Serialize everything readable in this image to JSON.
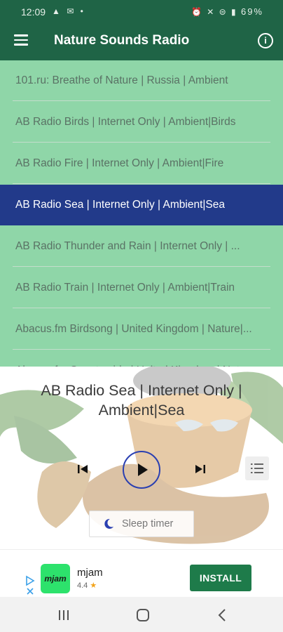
{
  "status_bar": {
    "time": "12:09",
    "left_icons": "▲ ✉ •",
    "right_icons": "⏰ ✕ ⊜ ▮",
    "battery": "69%"
  },
  "app_bar": {
    "title": "Nature Sounds Radio",
    "menu_icon": "hamburger-menu-icon",
    "info_icon": "info-icon",
    "info_glyph": "i"
  },
  "stations": [
    {
      "label": "101.ru: Breathe of Nature | Russia | Ambient",
      "selected": false
    },
    {
      "label": "AB Radio Birds | Internet Only | Ambient|Birds",
      "selected": false
    },
    {
      "label": "AB Radio Fire | Internet Only | Ambient|Fire",
      "selected": false
    },
    {
      "label": "AB Radio Sea | Internet Only | Ambient|Sea",
      "selected": true
    },
    {
      "label": "AB Radio Thunder and Rain | Internet Only | ...",
      "selected": false
    },
    {
      "label": "AB Radio Train | Internet Only | Ambient|Train",
      "selected": false
    },
    {
      "label": "Abacus.fm Birdsong | United Kingdom | Nature|...",
      "selected": false
    },
    {
      "label": "Abacus.fm Countryside | United Kingdom | Nature",
      "selected": false
    }
  ],
  "player": {
    "now_playing": "AB Radio Sea | Internet Only | Ambient|Sea",
    "sleep_timer_label": "Sleep timer"
  },
  "ad": {
    "app_name": "mjam",
    "logo_text": "mjam",
    "rating": "4.4",
    "install_label": "INSTALL"
  },
  "colors": {
    "app_bar": "#1f6446",
    "list_bg": "#8fd6a8",
    "selected_bg": "#223a8a",
    "accent": "#2a3fb1",
    "install": "#1e7b4a"
  }
}
